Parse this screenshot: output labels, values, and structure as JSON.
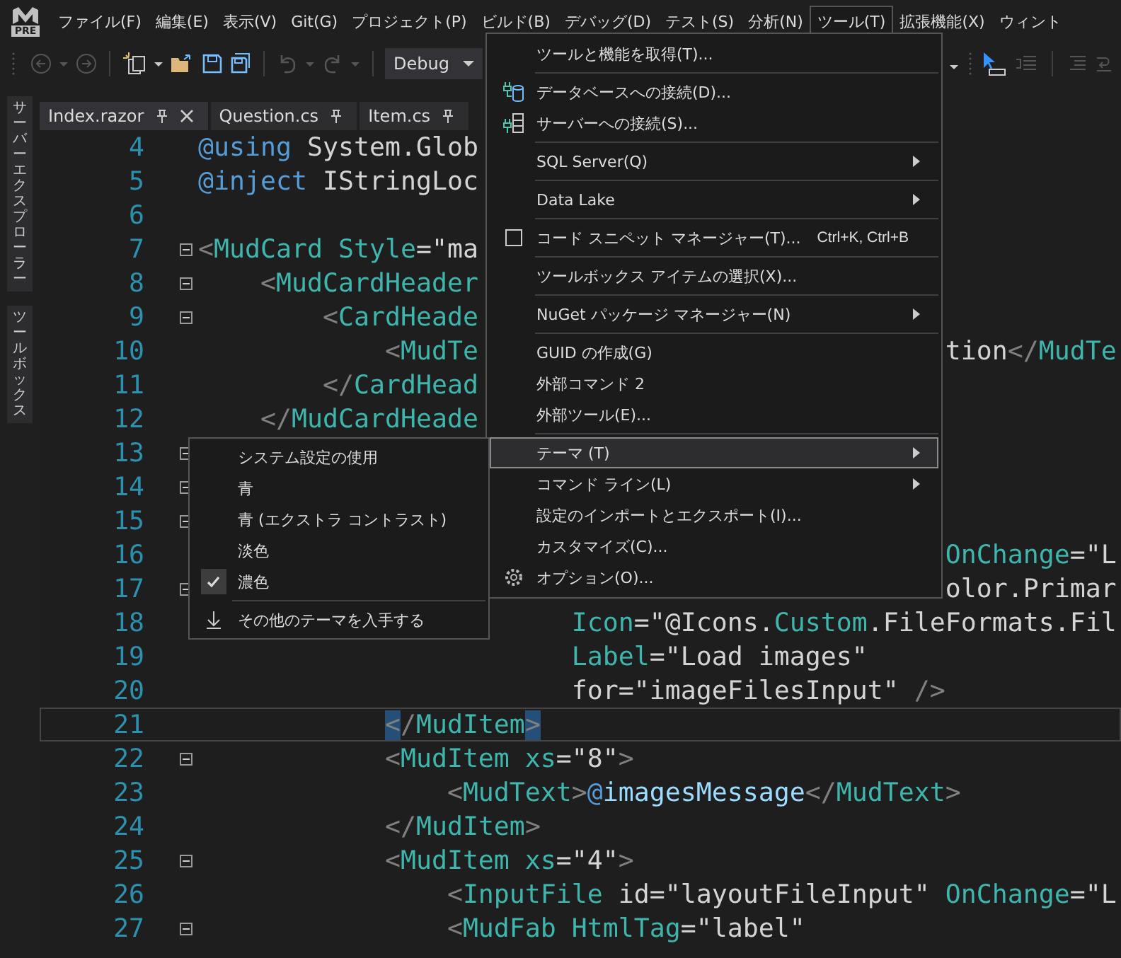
{
  "logo_badge": "PRE",
  "menubar": [
    {
      "label": "ファイル(F)",
      "selected": false
    },
    {
      "label": "編集(E)",
      "selected": false
    },
    {
      "label": "表示(V)",
      "selected": false
    },
    {
      "label": "Git(G)",
      "selected": false
    },
    {
      "label": "プロジェクト(P)",
      "selected": false
    },
    {
      "label": "ビルド(B)",
      "selected": false
    },
    {
      "label": "デバッグ(D)",
      "selected": false
    },
    {
      "label": "テスト(S)",
      "selected": false
    },
    {
      "label": "分析(N)",
      "selected": false
    },
    {
      "label": "ツール(T)",
      "selected": true
    },
    {
      "label": "拡張機能(X)",
      "selected": false
    },
    {
      "label": "ウィント",
      "selected": false
    }
  ],
  "toolbar": {
    "configuration": "Debug"
  },
  "side_tabs": [
    "サーバーエクスプローラー",
    "ツールボックス"
  ],
  "tabs": [
    {
      "label": "Index.razor",
      "selected": true
    },
    {
      "label": "Question.cs",
      "selected": false
    },
    {
      "label": "Item.cs",
      "selected": false
    }
  ],
  "editor": {
    "lines": [
      {
        "number": "4",
        "kind": "code",
        "fold": false,
        "current": false,
        "segments": [
          {
            "kind": "keyword",
            "text": "@using"
          },
          {
            "kind": "text",
            "text": " System.Glob"
          }
        ]
      },
      {
        "number": "5",
        "kind": "code",
        "fold": false,
        "current": false,
        "segments": [
          {
            "kind": "keyword",
            "text": "@inject"
          },
          {
            "kind": "text",
            "text": " IStringLoc"
          }
        ]
      },
      {
        "number": "6",
        "kind": "code",
        "fold": false,
        "current": false
      },
      {
        "number": "7",
        "kind": "code",
        "fold": true,
        "current": false,
        "segments": [
          {
            "kind": "punct",
            "text": "<"
          },
          {
            "kind": "tag",
            "text": "MudCard Style"
          },
          {
            "kind": "text",
            "text": "=\"ma"
          }
        ],
        "children": [
          {
            "number": "8",
            "kind": "code",
            "fold": true,
            "current": false,
            "segments": [
              {
                "kind": "punct",
                "text": "<"
              },
              {
                "kind": "tag",
                "text": "MudCardHeader"
              }
            ],
            "children": [
              {
                "number": "9",
                "kind": "code",
                "fold": true,
                "current": false,
                "segments": [
                  {
                    "kind": "punct",
                    "text": "<"
                  },
                  {
                    "kind": "tag",
                    "text": "CardHeade"
                  }
                ],
                "children": [
                  {
                    "number": "10",
                    "kind": "code",
                    "fold": false,
                    "current": false,
                    "segments": [
                      {
                        "kind": "punct",
                        "text": "<"
                      },
                      {
                        "kind": "tag",
                        "text": "MudTe"
                      }
                    ],
                    "right_segments": [
                      {
                        "kind": "text",
                        "text": "tion"
                      },
                      {
                        "kind": "punct",
                        "text": "</"
                      },
                      {
                        "kind": "tag",
                        "text": "MudTe"
                      }
                    ]
                  }
                ]
              },
              {
                "number": "11",
                "kind": "code",
                "fold": false,
                "current": false,
                "segments": [
                  {
                    "kind": "punct",
                    "text": "</"
                  },
                  {
                    "kind": "tag",
                    "text": "CardHead"
                  }
                ]
              }
            ]
          },
          {
            "number": "12",
            "kind": "code",
            "fold": false,
            "current": false,
            "segments": [
              {
                "kind": "punct",
                "text": "</"
              },
              {
                "kind": "tag",
                "text": "MudCardHeade"
              }
            ]
          },
          {
            "number": "13",
            "kind": "code",
            "fold": true,
            "current": false,
            "children": [
              {
                "number": "14",
                "kind": "code",
                "fold": true,
                "current": false,
                "children": [
                  {
                    "number": "15",
                    "kind": "code",
                    "fold": true,
                    "current": false,
                    "children": [
                      {
                        "number": "16",
                        "kind": "code",
                        "fold": false,
                        "current": false,
                        "right_segments": [
                          {
                            "kind": "tag",
                            "text": "OnChange"
                          },
                          {
                            "kind": "text",
                            "text": "=\"L"
                          }
                        ]
                      },
                      {
                        "number": "17",
                        "kind": "code",
                        "fold": true,
                        "current": false,
                        "right_segments": [
                          {
                            "kind": "text",
                            "text": "olor.Primar"
                          }
                        ],
                        "children": [
                          {
                            "number": "18",
                            "kind": "attribute",
                            "fold": false,
                            "current": false,
                            "segments": [
                              {
                                "kind": "tag",
                                "text": "Icon"
                              },
                              {
                                "kind": "text",
                                "text": "=\"@Icons."
                              },
                              {
                                "kind": "tag",
                                "text": "Custom"
                              },
                              {
                                "kind": "text",
                                "text": ".FileFormats.Fil"
                              }
                            ]
                          },
                          {
                            "number": "19",
                            "kind": "attribute",
                            "fold": false,
                            "current": false,
                            "segments": [
                              {
                                "kind": "tag",
                                "text": "Label"
                              },
                              {
                                "kind": "text",
                                "text": "=\"Load images\""
                              }
                            ]
                          },
                          {
                            "number": "20",
                            "kind": "attribute",
                            "fold": false,
                            "current": false,
                            "segments": [
                              {
                                "kind": "text",
                                "text": "for=\"imageFilesInput\""
                              },
                              {
                                "kind": "punct",
                                "text": " />"
                              }
                            ]
                          }
                        ]
                      }
                    ]
                  },
                  {
                    "number": "21",
                    "kind": "code",
                    "fold": false,
                    "current": true,
                    "segments": [
                      {
                        "kind": "brace",
                        "text": "<"
                      },
                      {
                        "kind": "punct",
                        "text": "/"
                      },
                      {
                        "kind": "tag",
                        "text": "MudItem"
                      },
                      {
                        "kind": "brace",
                        "text": ">"
                      }
                    ]
                  },
                  {
                    "number": "22",
                    "kind": "code",
                    "fold": true,
                    "current": false,
                    "segments": [
                      {
                        "kind": "punct",
                        "text": "<"
                      },
                      {
                        "kind": "tag",
                        "text": "MudItem xs"
                      },
                      {
                        "kind": "text",
                        "text": "=\"8\""
                      },
                      {
                        "kind": "punct",
                        "text": ">"
                      }
                    ],
                    "children": [
                      {
                        "number": "23",
                        "kind": "code",
                        "fold": false,
                        "current": false,
                        "segments": [
                          {
                            "kind": "punct",
                            "text": "<"
                          },
                          {
                            "kind": "tag",
                            "text": "MudText"
                          },
                          {
                            "kind": "punct",
                            "text": ">"
                          },
                          {
                            "kind": "keyword",
                            "text": "@"
                          },
                          {
                            "kind": "var",
                            "text": "imagesMessage"
                          },
                          {
                            "kind": "punct",
                            "text": "</"
                          },
                          {
                            "kind": "tag",
                            "text": "MudText"
                          },
                          {
                            "kind": "punct",
                            "text": ">"
                          }
                        ]
                      }
                    ]
                  },
                  {
                    "number": "24",
                    "kind": "code",
                    "fold": false,
                    "current": false,
                    "segments": [
                      {
                        "kind": "punct",
                        "text": "</"
                      },
                      {
                        "kind": "tag",
                        "text": "MudItem"
                      },
                      {
                        "kind": "punct",
                        "text": ">"
                      }
                    ]
                  },
                  {
                    "number": "25",
                    "kind": "code",
                    "fold": true,
                    "current": false,
                    "segments": [
                      {
                        "kind": "punct",
                        "text": "<"
                      },
                      {
                        "kind": "tag",
                        "text": "MudItem xs"
                      },
                      {
                        "kind": "text",
                        "text": "=\"4\""
                      },
                      {
                        "kind": "punct",
                        "text": ">"
                      }
                    ],
                    "children": [
                      {
                        "number": "26",
                        "kind": "code",
                        "fold": false,
                        "current": false,
                        "segments": [
                          {
                            "kind": "punct",
                            "text": "<"
                          },
                          {
                            "kind": "tag",
                            "text": "InputFile"
                          },
                          {
                            "kind": "text",
                            "text": " id=\"layoutFileInput\" "
                          },
                          {
                            "kind": "tag",
                            "text": "OnChange"
                          },
                          {
                            "kind": "text",
                            "text": "=\"L"
                          }
                        ]
                      },
                      {
                        "number": "27",
                        "kind": "code",
                        "fold": true,
                        "current": false,
                        "segments": [
                          {
                            "kind": "punct",
                            "text": "<"
                          },
                          {
                            "kind": "tag",
                            "text": "MudFab HtmlTag"
                          },
                          {
                            "kind": "text",
                            "text": "=\"label\""
                          }
                        ]
                      }
                    ]
                  }
                ]
              }
            ]
          }
        ]
      }
    ]
  },
  "tools_menu": [
    {
      "label": "ツールと機能を取得(T)...",
      "submenu": false,
      "selected": false,
      "separator_after": true
    },
    {
      "label": "データベースへの接続(D)...",
      "submenu": false,
      "selected": false,
      "separator_after": false
    },
    {
      "label": "サーバーへの接続(S)...",
      "submenu": false,
      "selected": false,
      "separator_after": true
    },
    {
      "label": "SQL Server(Q)",
      "submenu": true,
      "selected": false,
      "separator_after": true
    },
    {
      "label": "Data Lake",
      "submenu": true,
      "selected": false,
      "separator_after": true
    },
    {
      "label": "コード スニペット マネージャー(T)...",
      "shortcut": "Ctrl+K, Ctrl+B",
      "submenu": false,
      "selected": false,
      "separator_after": true
    },
    {
      "label": "ツールボックス アイテムの選択(X)...",
      "submenu": false,
      "selected": false,
      "separator_after": true
    },
    {
      "label": "NuGet パッケージ マネージャー(N)",
      "submenu": true,
      "selected": false,
      "separator_after": true
    },
    {
      "label": "GUID の作成(G)",
      "submenu": false,
      "selected": false,
      "separator_after": false
    },
    {
      "label": "外部コマンド 2",
      "submenu": false,
      "selected": false,
      "separator_after": false
    },
    {
      "label": "外部ツール(E)...",
      "submenu": false,
      "selected": false,
      "separator_after": true
    },
    {
      "label": "テーマ (T)",
      "submenu": true,
      "selected": true,
      "separator_after": false
    },
    {
      "label": "コマンド ライン(L)",
      "submenu": true,
      "selected": false,
      "separator_after": false
    },
    {
      "label": "設定のインポートとエクスポート(I)...",
      "submenu": false,
      "selected": false,
      "separator_after": false
    },
    {
      "label": "カスタマイズ(C)...",
      "submenu": false,
      "selected": false,
      "separator_after": false
    },
    {
      "label": "オプション(O)...",
      "submenu": false,
      "selected": false,
      "separator_after": false
    }
  ],
  "theme_menu": [
    {
      "kind": "option",
      "label": "システム設定の使用",
      "checked": false
    },
    {
      "kind": "option",
      "label": "青",
      "checked": false
    },
    {
      "kind": "option",
      "label": "青 (エクストラ コントラスト)",
      "checked": false
    },
    {
      "kind": "option",
      "label": "淡色",
      "checked": false
    },
    {
      "kind": "option",
      "label": "濃色",
      "checked": true
    },
    {
      "kind": "action",
      "label": "その他のテーマを入手する"
    }
  ]
}
